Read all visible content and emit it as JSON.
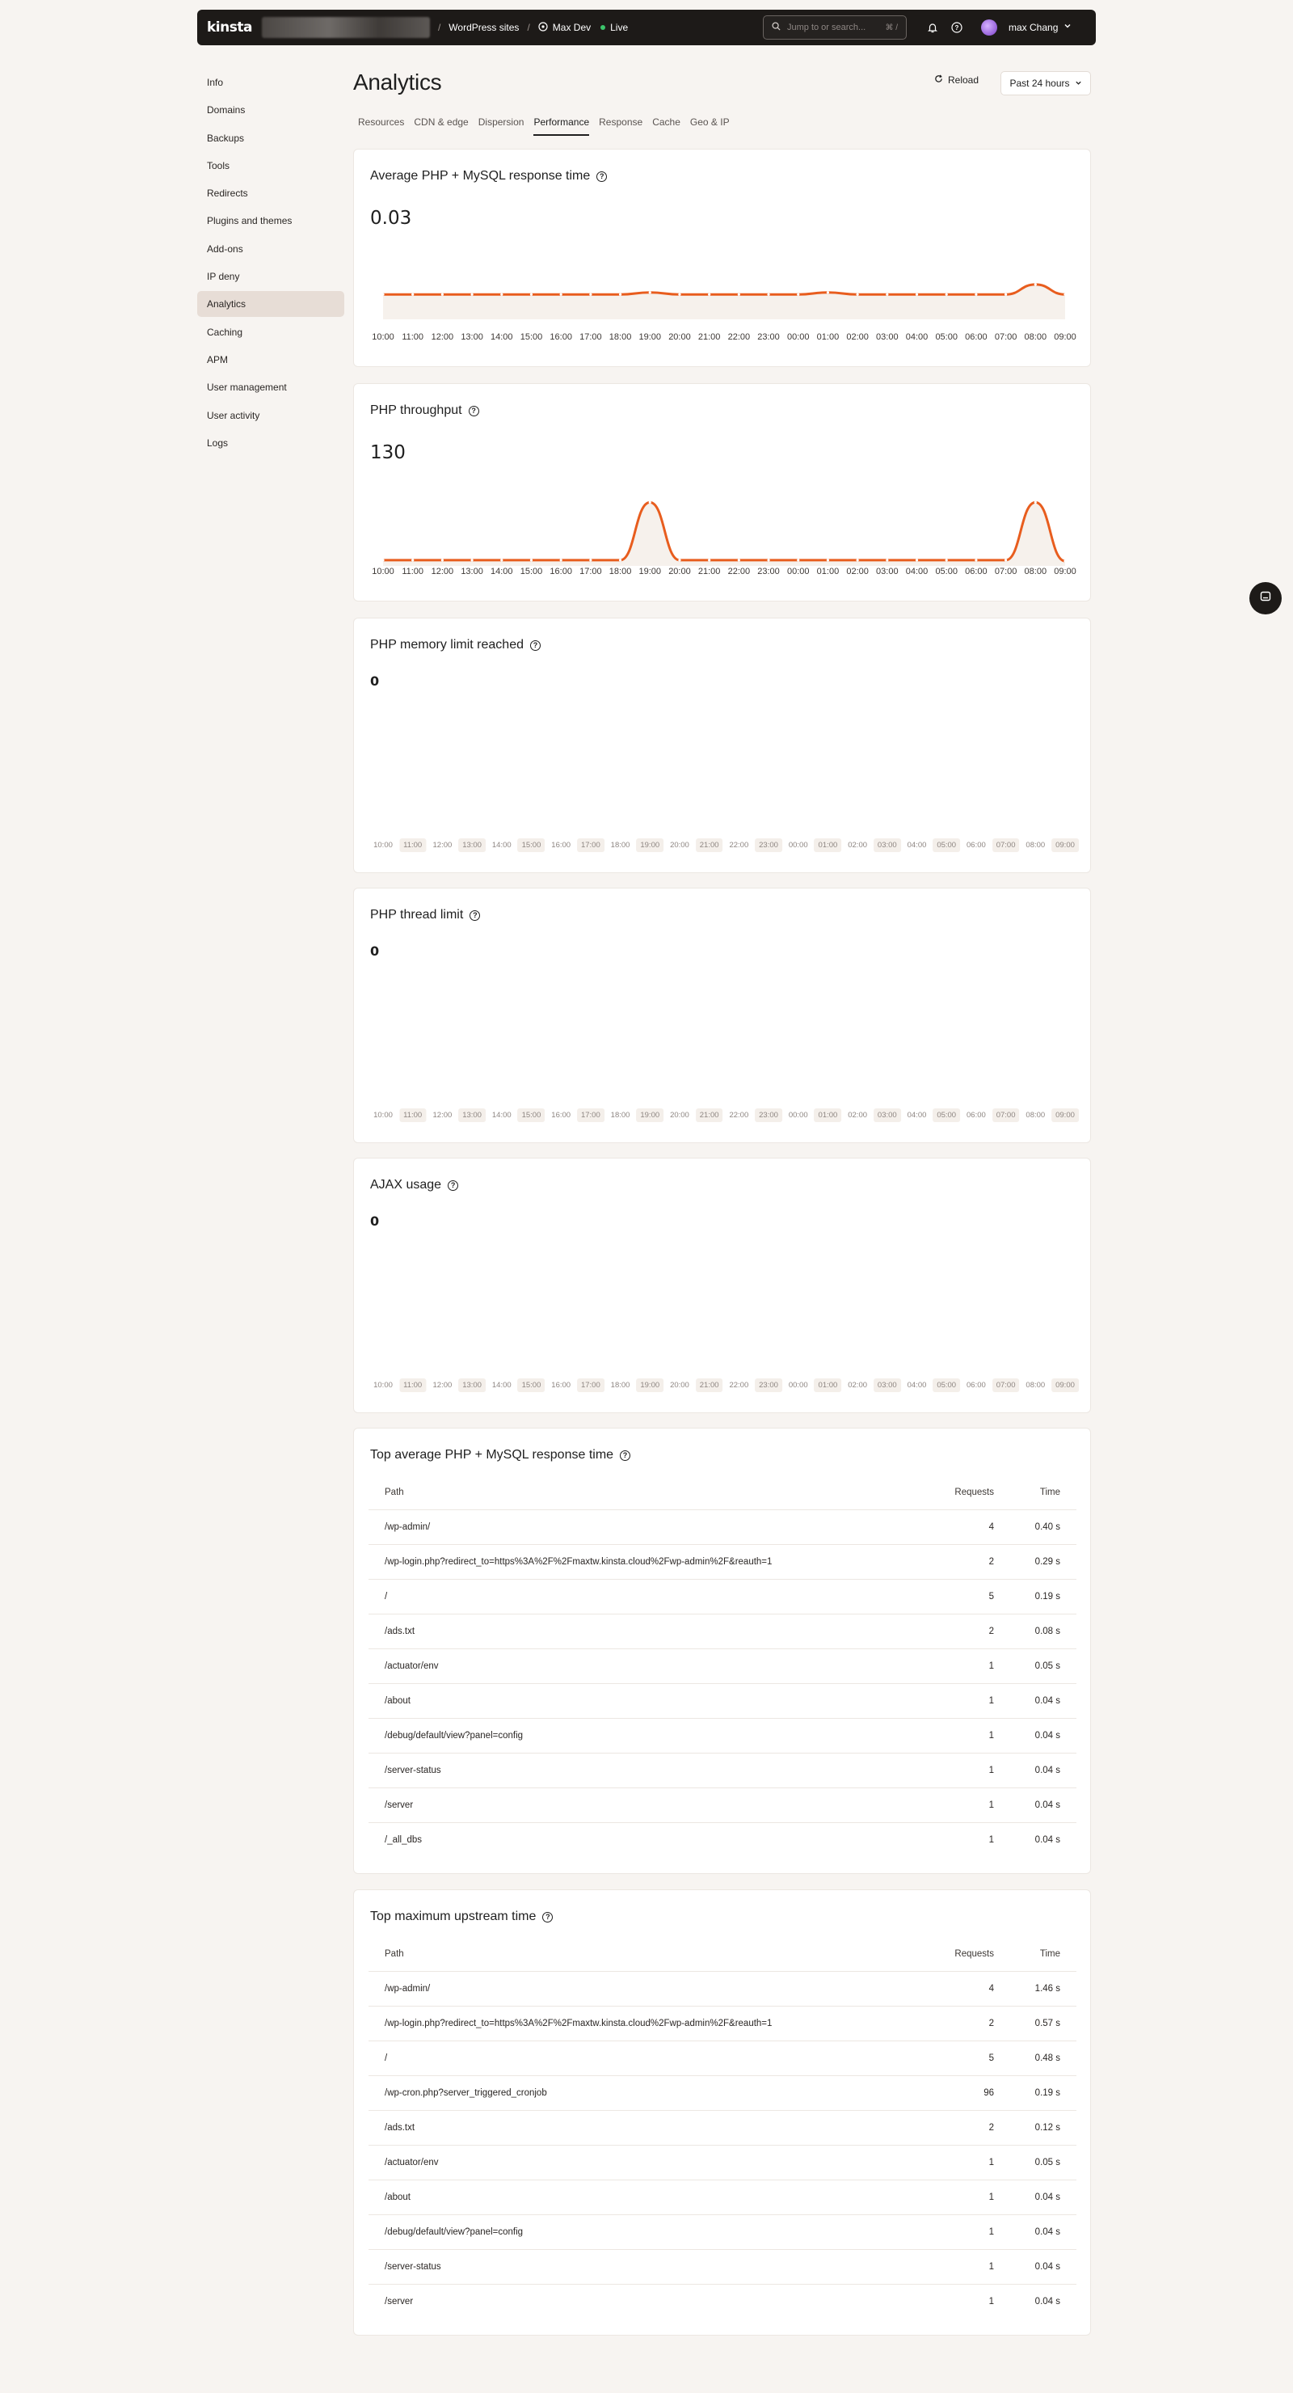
{
  "topbar": {
    "logo": "kinsta",
    "crumb_sites": "WordPress sites",
    "crumb_site": "Max Dev",
    "env": "Live",
    "search_placeholder": "Jump to or search...",
    "search_shortcut": "⌘ /",
    "user": "max Chang"
  },
  "sidebar": {
    "items": [
      {
        "label": "Info"
      },
      {
        "label": "Domains"
      },
      {
        "label": "Backups"
      },
      {
        "label": "Tools"
      },
      {
        "label": "Redirects"
      },
      {
        "label": "Plugins and themes"
      },
      {
        "label": "Add-ons"
      },
      {
        "label": "IP deny"
      },
      {
        "label": "Analytics"
      },
      {
        "label": "Caching"
      },
      {
        "label": "APM"
      },
      {
        "label": "User management"
      },
      {
        "label": "User activity"
      },
      {
        "label": "Logs"
      }
    ],
    "active": "Analytics"
  },
  "page": {
    "title": "Analytics",
    "reload": "Reload",
    "range": "Past 24 hours",
    "tabs": [
      "Resources",
      "CDN & edge",
      "Dispersion",
      "Performance",
      "Response",
      "Cache",
      "Geo & IP"
    ],
    "active_tab": "Performance"
  },
  "charts": {
    "response_time": {
      "title": "Average PHP + MySQL response time",
      "value": "0.03"
    },
    "throughput": {
      "title": "PHP throughput",
      "value": "130"
    },
    "memory": {
      "title": "PHP memory limit reached",
      "value": "0"
    },
    "thread": {
      "title": "PHP thread limit",
      "value": "0"
    },
    "ajax": {
      "title": "AJAX usage",
      "value": "0"
    }
  },
  "chart_data": [
    {
      "type": "line",
      "title": "Average PHP + MySQL response time",
      "x": [
        "10:00",
        "11:00",
        "12:00",
        "13:00",
        "14:00",
        "15:00",
        "16:00",
        "17:00",
        "18:00",
        "19:00",
        "20:00",
        "21:00",
        "22:00",
        "23:00",
        "00:00",
        "01:00",
        "02:00",
        "03:00",
        "04:00",
        "05:00",
        "06:00",
        "07:00",
        "08:00",
        "09:00"
      ],
      "values": [
        0.03,
        0.03,
        0.03,
        0.03,
        0.03,
        0.03,
        0.03,
        0.03,
        0.03,
        0.033,
        0.03,
        0.03,
        0.03,
        0.03,
        0.03,
        0.033,
        0.03,
        0.03,
        0.03,
        0.03,
        0.03,
        0.03,
        0.045,
        0.03
      ],
      "color": "#e85d1e"
    },
    {
      "type": "line",
      "title": "PHP throughput",
      "x": [
        "10:00",
        "11:00",
        "12:00",
        "13:00",
        "14:00",
        "15:00",
        "16:00",
        "17:00",
        "18:00",
        "19:00",
        "20:00",
        "21:00",
        "22:00",
        "23:00",
        "00:00",
        "01:00",
        "02:00",
        "03:00",
        "04:00",
        "05:00",
        "06:00",
        "07:00",
        "08:00",
        "09:00"
      ],
      "values": [
        2,
        2,
        2,
        2,
        2,
        2,
        2,
        2,
        2,
        130,
        2,
        2,
        2,
        2,
        2,
        2,
        2,
        2,
        2,
        2,
        2,
        2,
        130,
        0
      ],
      "color": "#e85d1e"
    },
    {
      "type": "line",
      "title": "PHP memory limit reached",
      "x": [
        "10:00",
        "11:00",
        "12:00",
        "13:00",
        "14:00",
        "15:00",
        "16:00",
        "17:00",
        "18:00",
        "19:00",
        "20:00",
        "21:00",
        "22:00",
        "23:00",
        "00:00",
        "01:00",
        "02:00",
        "03:00",
        "04:00",
        "05:00",
        "06:00",
        "07:00",
        "08:00",
        "09:00"
      ],
      "values": [
        0,
        0,
        0,
        0,
        0,
        0,
        0,
        0,
        0,
        0,
        0,
        0,
        0,
        0,
        0,
        0,
        0,
        0,
        0,
        0,
        0,
        0,
        0,
        0
      ]
    },
    {
      "type": "line",
      "title": "PHP thread limit",
      "x": [
        "10:00",
        "11:00",
        "12:00",
        "13:00",
        "14:00",
        "15:00",
        "16:00",
        "17:00",
        "18:00",
        "19:00",
        "20:00",
        "21:00",
        "22:00",
        "23:00",
        "00:00",
        "01:00",
        "02:00",
        "03:00",
        "04:00",
        "05:00",
        "06:00",
        "07:00",
        "08:00",
        "09:00"
      ],
      "values": [
        0,
        0,
        0,
        0,
        0,
        0,
        0,
        0,
        0,
        0,
        0,
        0,
        0,
        0,
        0,
        0,
        0,
        0,
        0,
        0,
        0,
        0,
        0,
        0
      ]
    },
    {
      "type": "line",
      "title": "AJAX usage",
      "x": [
        "10:00",
        "11:00",
        "12:00",
        "13:00",
        "14:00",
        "15:00",
        "16:00",
        "17:00",
        "18:00",
        "19:00",
        "20:00",
        "21:00",
        "22:00",
        "23:00",
        "00:00",
        "01:00",
        "02:00",
        "03:00",
        "04:00",
        "05:00",
        "06:00",
        "07:00",
        "08:00",
        "09:00"
      ],
      "values": [
        0,
        0,
        0,
        0,
        0,
        0,
        0,
        0,
        0,
        0,
        0,
        0,
        0,
        0,
        0,
        0,
        0,
        0,
        0,
        0,
        0,
        0,
        0,
        0
      ]
    }
  ],
  "table_response": {
    "title": "Top average PHP + MySQL response time",
    "headers": {
      "path": "Path",
      "requests": "Requests",
      "time": "Time"
    },
    "rows": [
      {
        "path": "/wp-admin/",
        "requests": "4",
        "time": "0.40 s"
      },
      {
        "path": "/wp-login.php?redirect_to=https%3A%2F%2Fmaxtw.kinsta.cloud%2Fwp-admin%2F&reauth=1",
        "requests": "2",
        "time": "0.29 s"
      },
      {
        "path": "/",
        "requests": "5",
        "time": "0.19 s"
      },
      {
        "path": "/ads.txt",
        "requests": "2",
        "time": "0.08 s"
      },
      {
        "path": "/actuator/env",
        "requests": "1",
        "time": "0.05 s"
      },
      {
        "path": "/about",
        "requests": "1",
        "time": "0.04 s"
      },
      {
        "path": "/debug/default/view?panel=config",
        "requests": "1",
        "time": "0.04 s"
      },
      {
        "path": "/server-status",
        "requests": "1",
        "time": "0.04 s"
      },
      {
        "path": "/server",
        "requests": "1",
        "time": "0.04 s"
      },
      {
        "path": "/_all_dbs",
        "requests": "1",
        "time": "0.04 s"
      }
    ]
  },
  "table_upstream": {
    "title": "Top maximum upstream time",
    "headers": {
      "path": "Path",
      "requests": "Requests",
      "time": "Time"
    },
    "rows": [
      {
        "path": "/wp-admin/",
        "requests": "4",
        "time": "1.46 s"
      },
      {
        "path": "/wp-login.php?redirect_to=https%3A%2F%2Fmaxtw.kinsta.cloud%2Fwp-admin%2F&reauth=1",
        "requests": "2",
        "time": "0.57 s"
      },
      {
        "path": "/",
        "requests": "5",
        "time": "0.48 s"
      },
      {
        "path": "/wp-cron.php?server_triggered_cronjob",
        "requests": "96",
        "time": "0.19 s"
      },
      {
        "path": "/ads.txt",
        "requests": "2",
        "time": "0.12 s"
      },
      {
        "path": "/actuator/env",
        "requests": "1",
        "time": "0.05 s"
      },
      {
        "path": "/about",
        "requests": "1",
        "time": "0.04 s"
      },
      {
        "path": "/debug/default/view?panel=config",
        "requests": "1",
        "time": "0.04 s"
      },
      {
        "path": "/server-status",
        "requests": "1",
        "time": "0.04 s"
      },
      {
        "path": "/server",
        "requests": "1",
        "time": "0.04 s"
      }
    ]
  },
  "icons": {
    "reload": "reload-icon",
    "bell": "bell-icon",
    "help": "help-icon",
    "chat": "chat-icon"
  },
  "colors": {
    "accent": "#e85d1e",
    "topbar": "#1d1a18",
    "live": "#3cc46b"
  }
}
